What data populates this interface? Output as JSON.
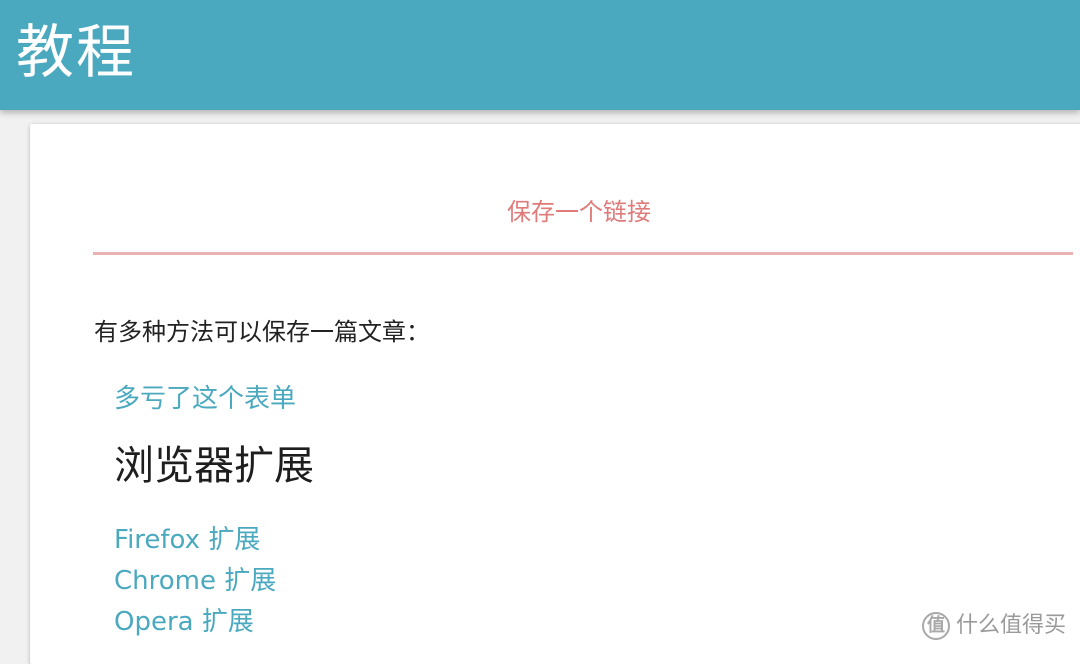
{
  "header": {
    "title": "教程"
  },
  "tab": {
    "label": "保存一个链接"
  },
  "content": {
    "intro": "有多种方法可以保存一篇文章：",
    "form_link": "多亏了这个表单",
    "extensions_heading": "浏览器扩展",
    "extensions": [
      {
        "label": "Firefox 扩展"
      },
      {
        "label": "Chrome 扩展"
      },
      {
        "label": "Opera 扩展"
      }
    ]
  },
  "watermark": {
    "logo_glyph": "值",
    "text": "什么值得买"
  },
  "colors": {
    "header_bg": "#4aa9bf",
    "tab_accent": "#e07b7b",
    "link": "#4aa9bf"
  }
}
